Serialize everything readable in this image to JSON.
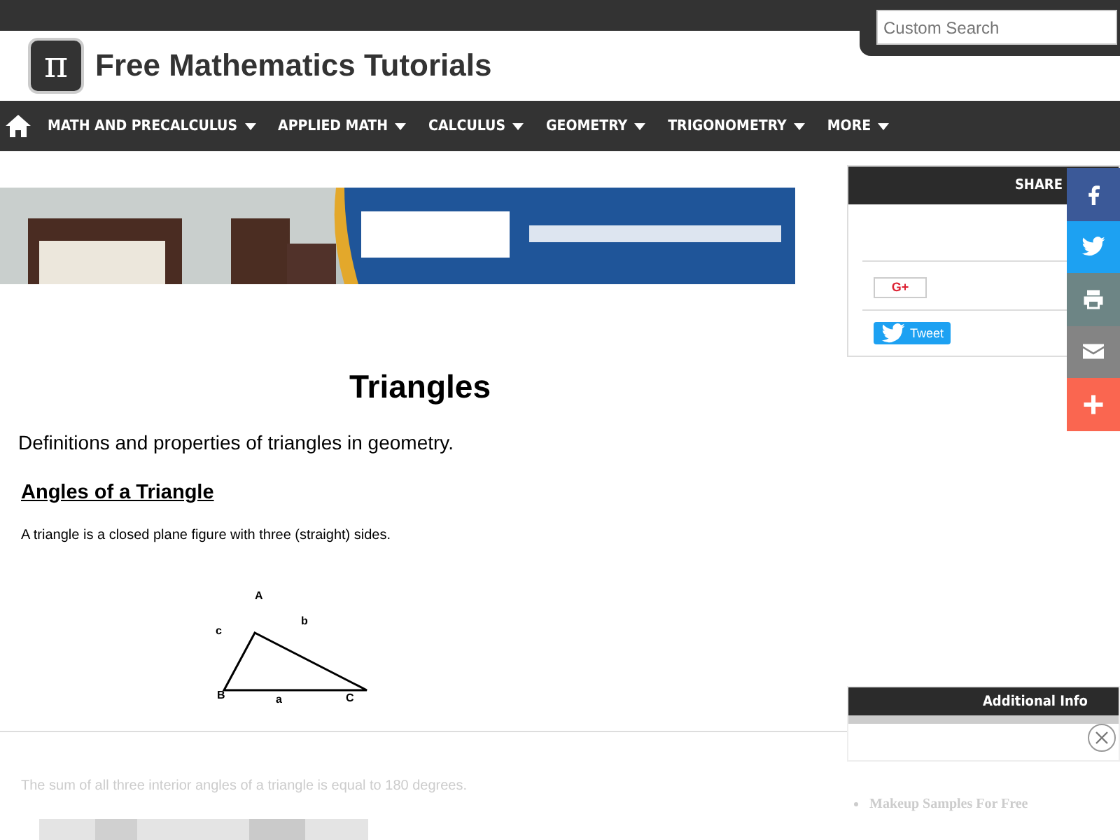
{
  "search": {
    "placeholder": "Custom Search"
  },
  "site": {
    "title": "Free Mathematics Tutorials",
    "logo": "π"
  },
  "nav": [
    {
      "label": "MATH AND PRECALCULUS"
    },
    {
      "label": "APPLIED MATH"
    },
    {
      "label": "CALCULUS"
    },
    {
      "label": "GEOMETRY"
    },
    {
      "label": "TRIGONOMETRY"
    },
    {
      "label": "MORE"
    }
  ],
  "article": {
    "title": "Triangles",
    "intro": "Definitions and properties of triangles in geometry.",
    "section": "Angles of a Triangle",
    "text": "A triangle is a closed plane figure with three (straight) sides.",
    "figure_labels": {
      "A": "A",
      "B": "B",
      "C": "C",
      "a": "a",
      "b": "b",
      "c": "c"
    },
    "faded_text": "The sum of all three interior angles of a triangle is equal to 180 degrees."
  },
  "share": {
    "title": "SHARE",
    "gplus": "G+",
    "tweet": "Tweet"
  },
  "social": [
    {
      "kind": "facebook",
      "color": "#3b5998"
    },
    {
      "kind": "twitter",
      "color": "#1da1f2"
    },
    {
      "kind": "print",
      "color": "#6d8585"
    },
    {
      "kind": "email",
      "color": "#848484"
    },
    {
      "kind": "more",
      "color": "#fa6650"
    }
  ],
  "additional": {
    "title": "Additional Info",
    "items": [
      "Makeup Samples For Free"
    ]
  }
}
